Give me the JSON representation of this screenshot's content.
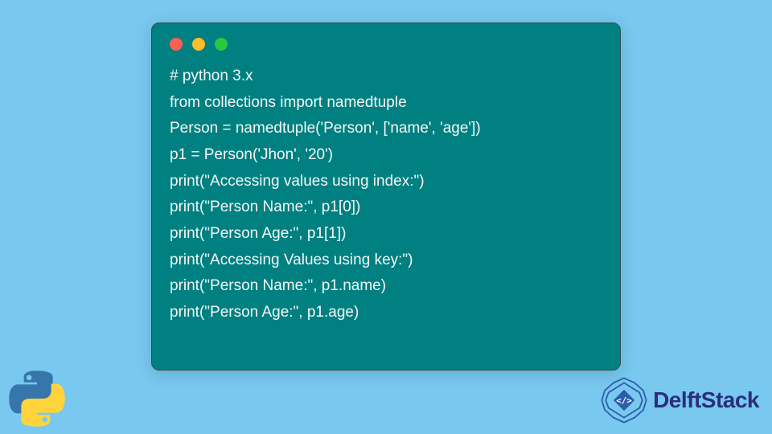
{
  "window": {
    "dots": [
      "red",
      "yellow",
      "green"
    ]
  },
  "code": {
    "lines": [
      "# python 3.x",
      "from collections import namedtuple",
      "Person = namedtuple('Person', ['name', 'age'])",
      "p1 = Person('Jhon', '20')",
      "print(\"Accessing values using index:\")",
      "print(\"Person Name:\", p1[0])",
      "print(\"Person Age:\", p1[1])",
      "print(\"Accessing Values using key:\")",
      "print(\"Person Name:\", p1.name)",
      "print(\"Person Age:\", p1.age)"
    ]
  },
  "brand": {
    "name": "DelftStack"
  },
  "icons": {
    "python": "python-logo",
    "delft": "delft-badge"
  }
}
